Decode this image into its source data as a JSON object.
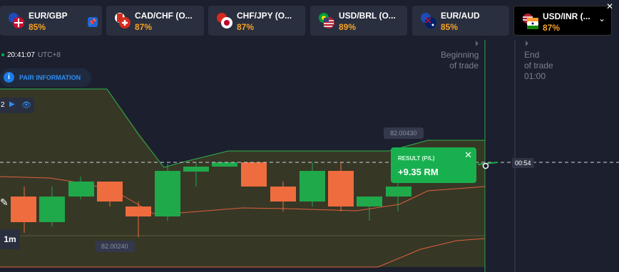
{
  "tabs": [
    {
      "pair": "EUR/GBP",
      "payout": "85%"
    },
    {
      "pair": "CAD/CHF (O...",
      "payout": "87%"
    },
    {
      "pair": "CHF/JPY (O...",
      "payout": "87%"
    },
    {
      "pair": "USD/BRL (O...",
      "payout": "89%"
    },
    {
      "pair": "EUR/AUD",
      "payout": "85%"
    },
    {
      "pair": "USD/INR (...",
      "payout": "87%"
    }
  ],
  "clock": {
    "time": "20:41:07",
    "tz": "UTC+8"
  },
  "pair_info_label": "PAIR INFORMATION",
  "indicator_count": "2",
  "timeframe": "1m",
  "markers": {
    "beginning_line1": "Beginning",
    "beginning_line2": "of trade",
    "end_line1": "End",
    "end_line2": "of trade",
    "end_time": "01:00"
  },
  "price_high": "82.00430",
  "price_low": "82.00240",
  "countdown": "00:54",
  "result": {
    "label": "RESULT (P/L)",
    "value": "+9.35 RM"
  },
  "colors": {
    "up": "#1fa94a",
    "down": "#ee6c3e",
    "band": "#3d3b24",
    "accent": "#1d7ce6",
    "payout": "#f6a226"
  }
}
